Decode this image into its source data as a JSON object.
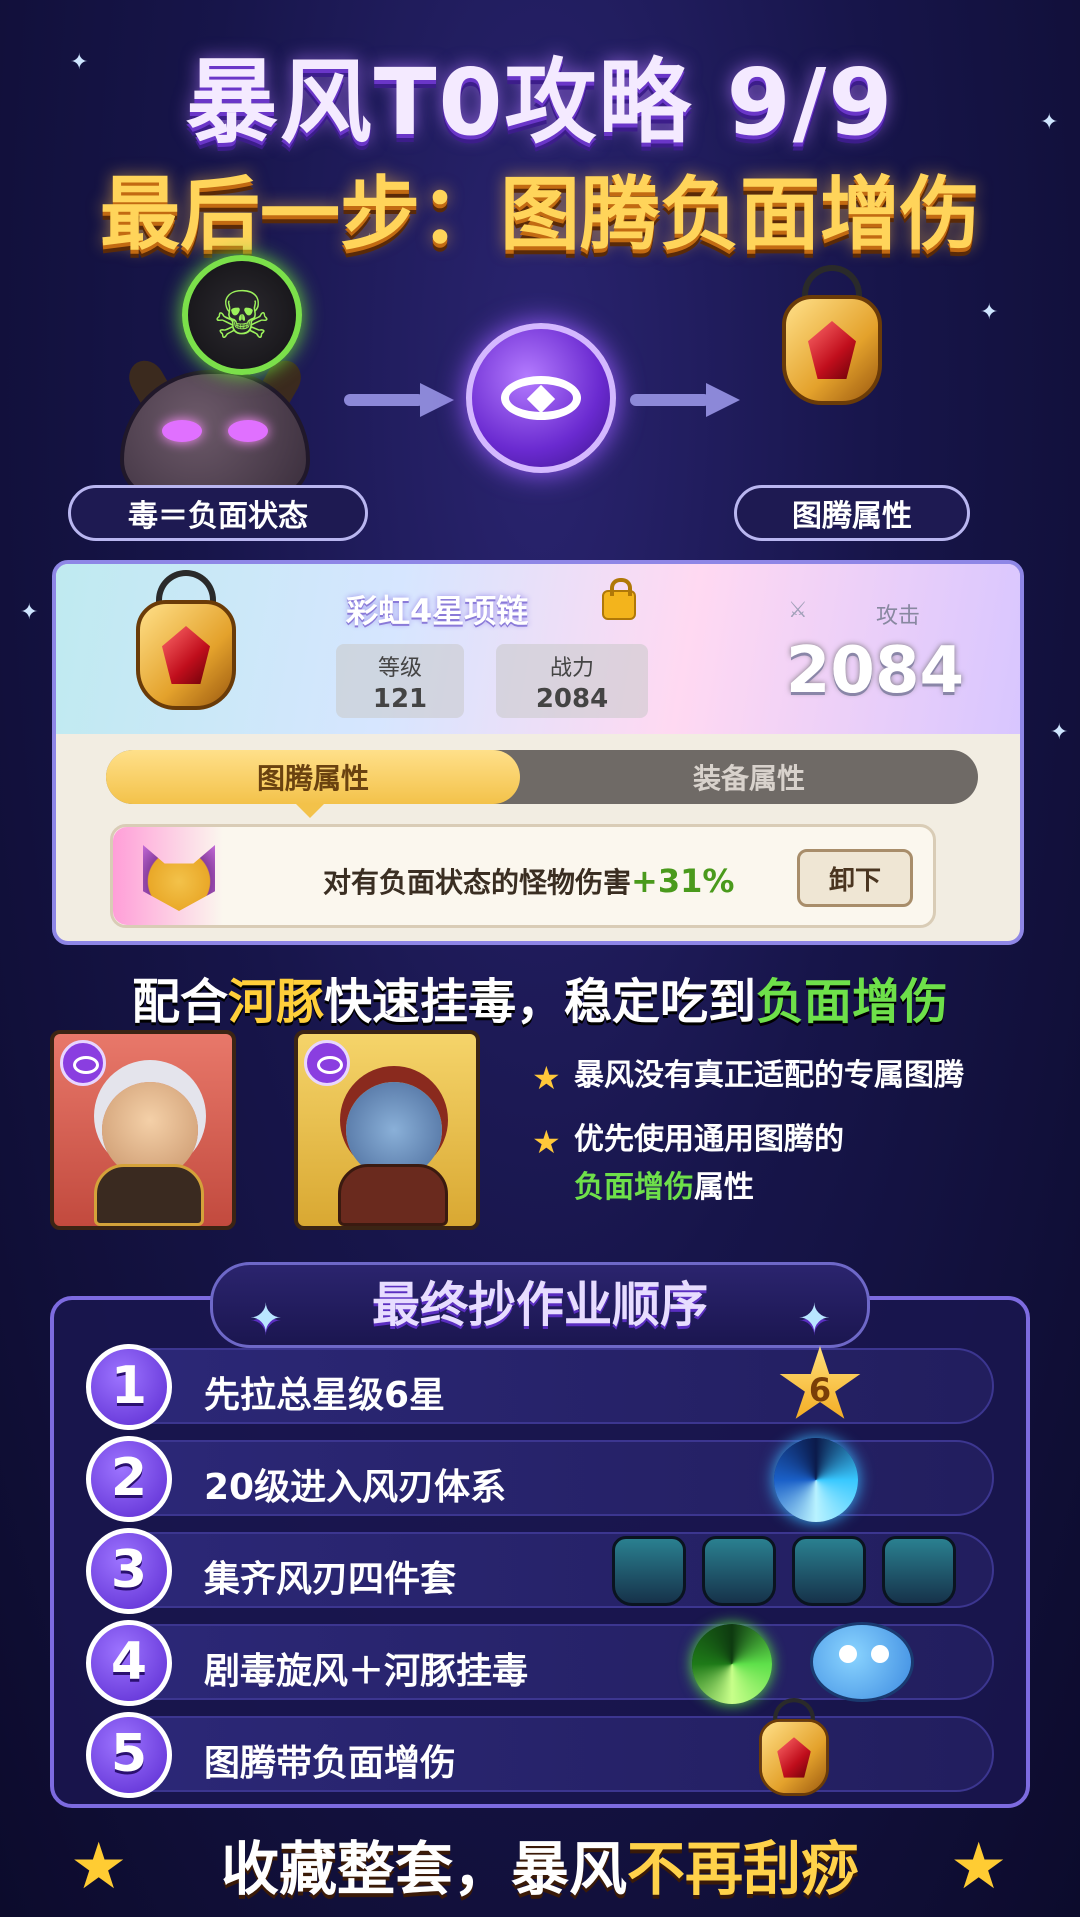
{
  "header": {
    "title": "暴风T0攻略 9/9",
    "subtitle": "最后一步：图腾负面增伤"
  },
  "flow": {
    "left_label": "毒＝负面状态",
    "right_label": "图腾属性",
    "left_icon": "skull-icon",
    "center_icon": "totem-eye-icon",
    "right_icon": "amulet-icon"
  },
  "equipment": {
    "name": "彩虹4星项链",
    "level_label": "等级",
    "level_value": "121",
    "power_label": "战力",
    "power_value": "2084",
    "attack_label": "攻击",
    "attack_value": "2084",
    "tab_active": "图腾属性",
    "tab_inactive": "装备属性",
    "attribute_text": "对有负面状态的怪物伤害",
    "attribute_value": "+31%",
    "unequip_label": "卸下"
  },
  "combo": {
    "part1": "配合",
    "pufferfish": "河豚",
    "part2": "快速挂毒，稳定吃到",
    "negative_boost": "负面增伤"
  },
  "notes": {
    "bullet1": "暴风没有真正适配的专属图腾",
    "bullet2_line1": "优先使用通用图腾的",
    "bullet2_highlight": "负面增伤",
    "bullet2_tail": "属性"
  },
  "order": {
    "title": "最终抄作业顺序",
    "steps": [
      {
        "num": "1",
        "text": "先拉总星级6星",
        "badge": "6"
      },
      {
        "num": "2",
        "text": "20级进入风刃体系"
      },
      {
        "num": "3",
        "text": "集齐风刃四件套"
      },
      {
        "num": "4",
        "text": "剧毒旋风＋河豚挂毒"
      },
      {
        "num": "5",
        "text": "图腾带负面增伤"
      }
    ]
  },
  "footer": {
    "part1": "收藏整套，暴风",
    "part2": "不再刮痧"
  },
  "colors": {
    "accent_yellow": "#ffcf3a",
    "accent_green": "#6ee04a",
    "accent_purple": "#7d6be0"
  }
}
